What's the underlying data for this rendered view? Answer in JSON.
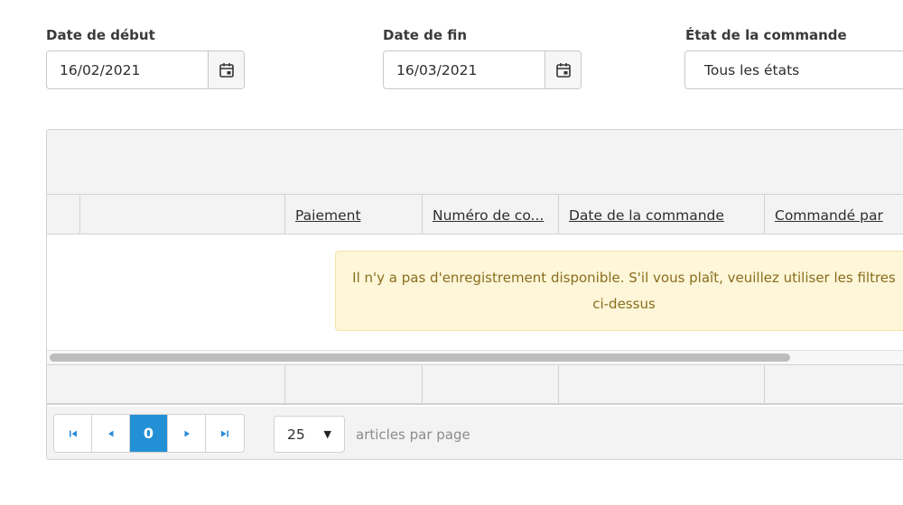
{
  "filters": {
    "start_date": {
      "label": "Date de début",
      "value": "16/02/2021",
      "icon": "calendar-icon"
    },
    "end_date": {
      "label": "Date de fin",
      "value": "16/03/2021",
      "icon": "calendar-icon"
    },
    "order_state": {
      "label": "État de la commande",
      "value": "Tous les états"
    }
  },
  "grid": {
    "columns": [
      "Paiement",
      "Numéro de co...",
      "Date de la commande",
      "Commandé par"
    ],
    "empty_message_line1": "Il n'y a pas d'enregistrement disponible. S'il vous plaît, veuillez utiliser les filtres",
    "empty_message_line2": "ci-dessus"
  },
  "pager": {
    "current_page": "0",
    "first_icon": "page-first-icon",
    "prev_icon": "page-prev-icon",
    "next_icon": "page-next-icon",
    "last_icon": "page-last-icon",
    "page_size": "25",
    "page_size_label": "articles par page"
  },
  "colors": {
    "accent": "#2390d6",
    "notice_bg": "#fdf6d8",
    "notice_text": "#8a6d1e"
  }
}
